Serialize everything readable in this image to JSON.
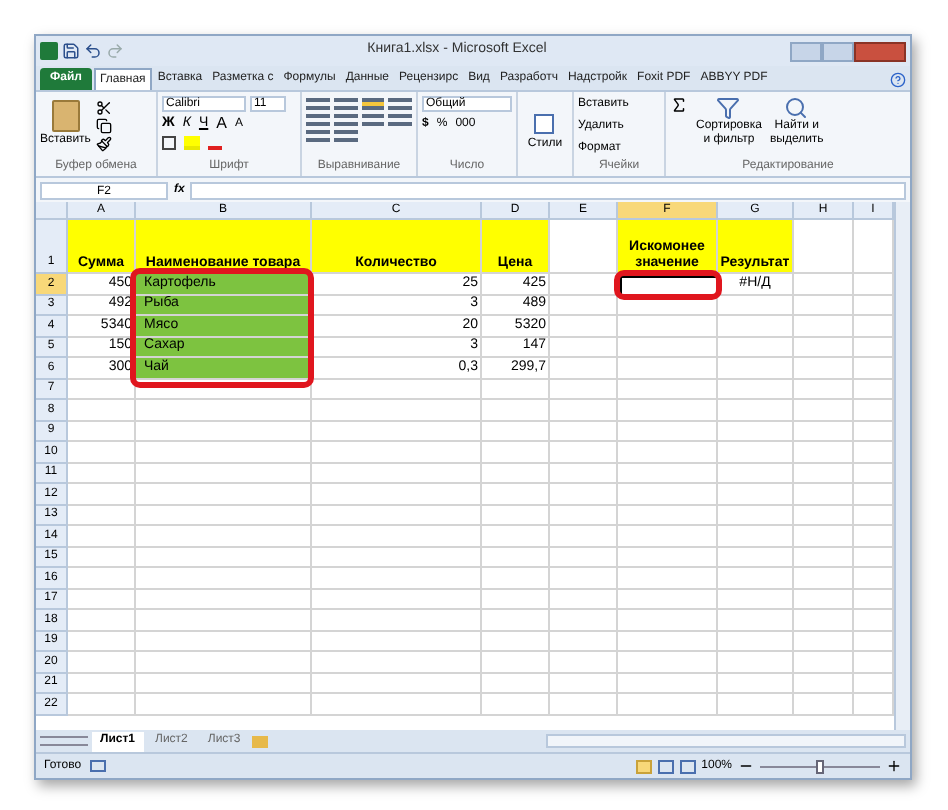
{
  "window": {
    "title": "Книга1.xlsx - Microsoft Excel"
  },
  "file_tab": {
    "label": "Файл"
  },
  "ribbon_tabs": [
    {
      "label": "Главная",
      "selected": true
    },
    {
      "label": "Вставка",
      "selected": false
    },
    {
      "label": "Разметка с",
      "selected": false
    },
    {
      "label": "Формулы",
      "selected": false
    },
    {
      "label": "Данные",
      "selected": false
    },
    {
      "label": "Рецензирс",
      "selected": false
    },
    {
      "label": "Вид",
      "selected": false
    },
    {
      "label": "Разработч",
      "selected": false
    },
    {
      "label": "Надстройк",
      "selected": false
    },
    {
      "label": "Foxit PDF",
      "selected": false
    },
    {
      "label": "ABBYY PDF",
      "selected": false
    }
  ],
  "ribbon": {
    "clipboard": {
      "paste": "Вставить",
      "group": "Буфер обмена"
    },
    "font": {
      "name": "Calibri",
      "size": "11",
      "bold": "Ж",
      "italic": "К",
      "underline": "Ч",
      "grow": "A",
      "shrink": "A",
      "group": "Шрифт"
    },
    "alignment": {
      "group": "Выравнивание"
    },
    "number": {
      "format": "Общий",
      "currency": "$",
      "percent": "%",
      "thousands": "000",
      "group": "Число"
    },
    "styles": {
      "label": "Стили"
    },
    "cells": {
      "insert": "Вставить",
      "delete": "Удалить",
      "format": "Формат",
      "group": "Ячейки"
    },
    "editing": {
      "sort": [
        "Сортировка",
        "и фильтр"
      ],
      "find": [
        "Найти и",
        "выделить"
      ],
      "group": "Редактирование"
    }
  },
  "formula_bar": {
    "name_box": "F2",
    "fx": "fx"
  },
  "columns": [
    "A",
    "B",
    "C",
    "D",
    "E",
    "F",
    "G",
    "H",
    "I"
  ],
  "rows": [
    {
      "number": "1",
      "cells": [
        {
          "text": "Сумма",
          "kind": "header"
        },
        {
          "text": "Наименование товара",
          "kind": "header"
        },
        {
          "text": "Количество",
          "kind": "header"
        },
        {
          "text": "Цена",
          "kind": "header"
        },
        {
          "kind": "empty"
        },
        {
          "text": "Искомонее значение",
          "kind": "header"
        },
        {
          "text": "Результат",
          "kind": "header"
        },
        {
          "kind": "empty"
        },
        {
          "kind": "empty"
        }
      ]
    },
    {
      "number": "2",
      "cells": [
        {
          "text": "450",
          "kind": "number"
        },
        {
          "text": "Картофель",
          "kind": "highlight"
        },
        {
          "text": "25",
          "kind": "number"
        },
        {
          "text": "425",
          "kind": "number"
        },
        {
          "kind": "empty"
        },
        {
          "kind": "active"
        },
        {
          "text": "#Н/Д",
          "kind": "result"
        },
        {
          "kind": "empty"
        },
        {
          "kind": "empty"
        }
      ]
    },
    {
      "number": "3",
      "cells": [
        {
          "text": "492",
          "kind": "number"
        },
        {
          "text": "Рыба",
          "kind": "highlight"
        },
        {
          "text": "3",
          "kind": "number"
        },
        {
          "text": "489",
          "kind": "number"
        }
      ]
    },
    {
      "number": "4",
      "cells": [
        {
          "text": "5340",
          "kind": "number"
        },
        {
          "text": "Мясо",
          "kind": "highlight"
        },
        {
          "text": "20",
          "kind": "number"
        },
        {
          "text": "5320",
          "kind": "number"
        }
      ]
    },
    {
      "number": "5",
      "cells": [
        {
          "text": "150",
          "kind": "number"
        },
        {
          "text": "Сахар",
          "kind": "highlight"
        },
        {
          "text": "3",
          "kind": "number"
        },
        {
          "text": "147",
          "kind": "number"
        }
      ]
    },
    {
      "number": "6",
      "cells": [
        {
          "text": "300",
          "kind": "number"
        },
        {
          "text": "Чай",
          "kind": "highlight"
        },
        {
          "text": "0,3",
          "kind": "number"
        },
        {
          "text": "299,7",
          "kind": "number"
        }
      ]
    },
    {
      "number": "7"
    },
    {
      "number": "8"
    },
    {
      "number": "9"
    },
    {
      "number": "10"
    },
    {
      "number": "11"
    },
    {
      "number": "12"
    },
    {
      "number": "13"
    },
    {
      "number": "14"
    },
    {
      "number": "15"
    },
    {
      "number": "16"
    },
    {
      "number": "17"
    },
    {
      "number": "18"
    },
    {
      "number": "19"
    },
    {
      "number": "20"
    },
    {
      "number": "21"
    },
    {
      "number": "22"
    }
  ],
  "sheet_tabs": [
    {
      "label": "Лист1",
      "selected": true
    },
    {
      "label": "Лист2",
      "selected": false
    },
    {
      "label": "Лист3",
      "selected": false
    }
  ],
  "status_bar": {
    "status": "Готово",
    "zoom": "100%",
    "zoom_slider": {
      "level": 0.5
    }
  }
}
